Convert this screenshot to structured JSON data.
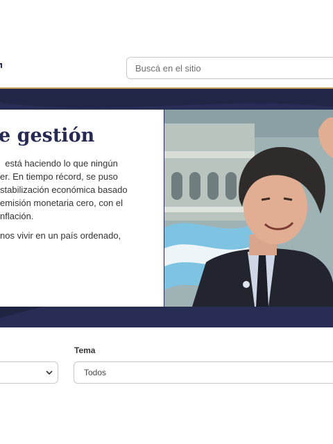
{
  "header": {
    "search_placeholder": "Buscá en el sitio"
  },
  "hero": {
    "title": "e gestión",
    "paragraph_lines": [
      "  está haciendo lo que ningún",
      "er. En tiempo récord, se puso",
      "stabilización económica basado",
      "emisión monetaria cero, con el",
      "nflación."
    ],
    "paragraph2": "nos vivir en un país ordenado,"
  },
  "filters": {
    "tema_label": "Tema",
    "tema_value": "Todos"
  },
  "colors": {
    "hero_bg": "#232749",
    "accent_gold": "#c8a15a",
    "title": "#262a52"
  }
}
